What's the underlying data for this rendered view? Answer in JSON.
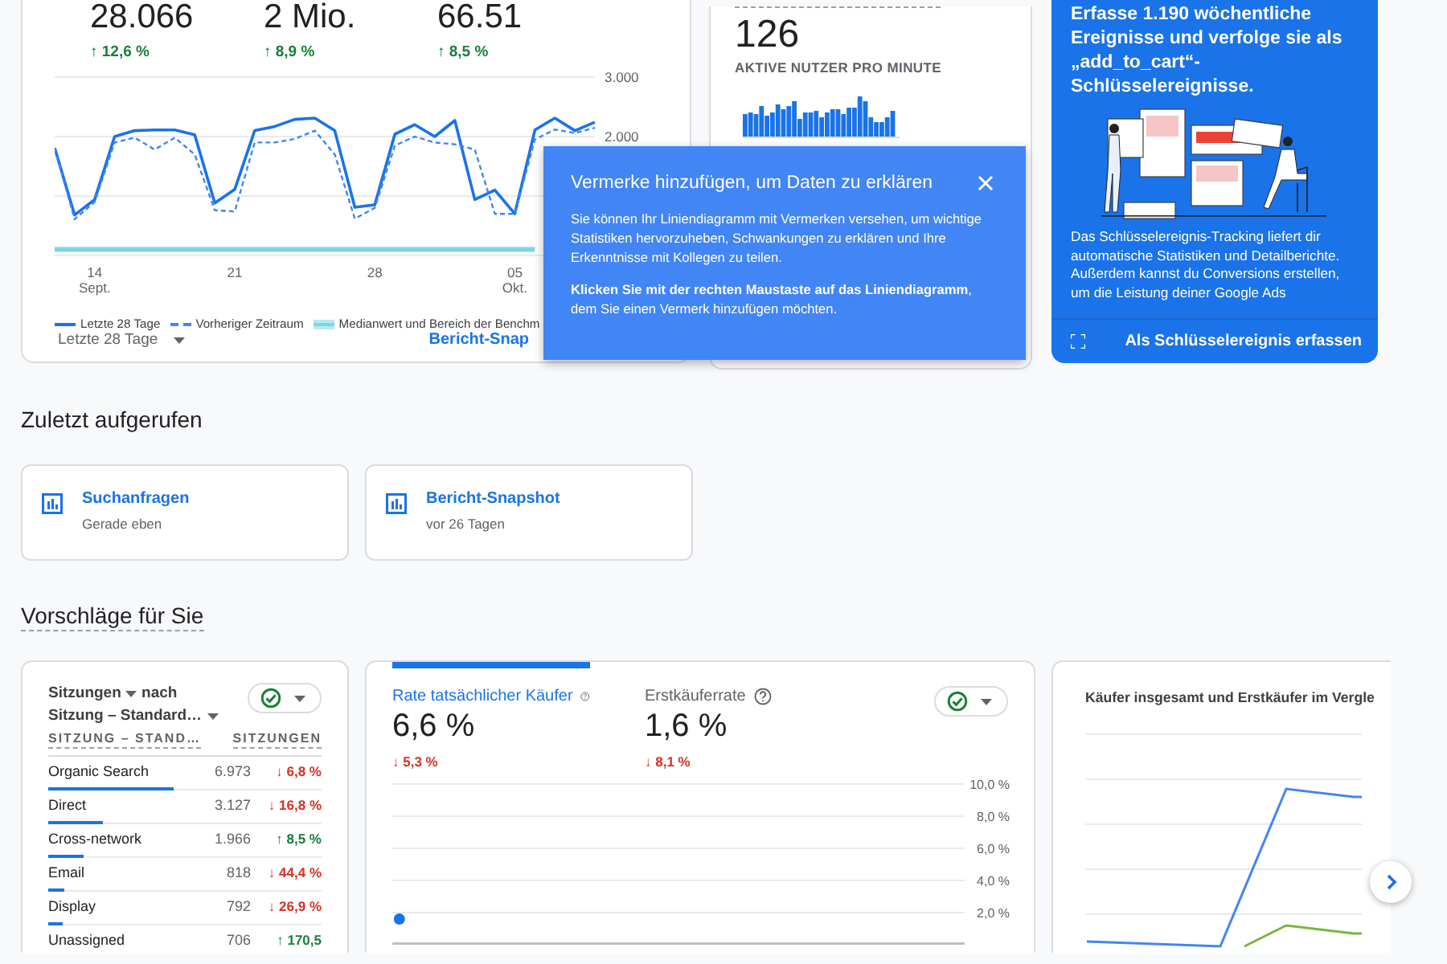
{
  "overview": {
    "metrics": [
      {
        "value": "28.066",
        "change": "↑ 12,6 %",
        "color": "#188038"
      },
      {
        "value": "2 Mio.",
        "change": "↑ 8,9 %",
        "color": "#188038"
      },
      {
        "value": "66.51",
        "change": "↑ 8,5 %",
        "color": "#188038"
      }
    ],
    "chart_data": {
      "type": "line",
      "categories": [
        null,
        null,
        "14 Sept.",
        null,
        null,
        null,
        null,
        null,
        null,
        "21",
        null,
        null,
        null,
        null,
        null,
        null,
        "28",
        null,
        null,
        null,
        null,
        null,
        null,
        "05 Okt.",
        null,
        null,
        null,
        null
      ],
      "ylim": [
        0,
        3000
      ],
      "grid": true,
      "yticks": [
        {
          "value": 2000,
          "label": "2.000"
        },
        {
          "value": 3000,
          "label": "3.000"
        }
      ],
      "series": [
        {
          "name": "Letzte 28 Tage",
          "color": "#1a73e8",
          "line_style": "solid",
          "values": [
            1810,
            680,
            940,
            2000,
            2100,
            2110,
            2110,
            2030,
            880,
            1110,
            2100,
            2170,
            2290,
            2310,
            2100,
            810,
            850,
            2040,
            2200,
            2000,
            2270,
            940,
            1100,
            700,
            2110,
            2310,
            2100,
            2240
          ]
        },
        {
          "name": "Vorheriger Zeitraum",
          "color": "#4285f4",
          "line_style": "dashed",
          "values": [
            1800,
            610,
            900,
            1900,
            1980,
            1780,
            1980,
            1700,
            760,
            740,
            1900,
            1900,
            1960,
            2100,
            1700,
            620,
            800,
            1850,
            2000,
            1900,
            1870,
            1780,
            700,
            700,
            1950,
            2120,
            2060,
            2150
          ]
        },
        {
          "name": "Medianwert und Bereich der Benchm",
          "color": "#80d4dc",
          "line_style": "solid",
          "values": [
            100,
            100,
            100,
            100,
            100,
            100,
            100,
            100,
            100,
            100,
            100,
            100,
            100,
            100,
            100,
            100,
            100,
            100,
            100,
            100,
            100,
            100,
            100,
            100,
            100,
            null,
            null,
            null
          ]
        }
      ]
    },
    "date_range": "Letzte 28 Tage",
    "link": "Bericht-Snap"
  },
  "realtime": {
    "value": "126",
    "label": "AKTIVE NUTZER PRO MINUTE"
  },
  "promo": {
    "headline": "Erfasse 1.190 wöchentliche Ereignisse und verfolge sie als „add_to_cart“-Schlüsselereignisse.",
    "body": "Das Schlüsselereignis-Tracking liefert dir automatische Statistiken und Detailberichte. Außerdem kannst du Conversions erstellen, um die Leistung deiner Google Ads",
    "action": "Als Schlüsselereignis erfassen"
  },
  "popup": {
    "title": "Vermerke hinzufügen, um Daten zu erklären",
    "body": "Sie können Ihr Liniendiagramm mit Vermerken versehen, um wichtige Statistiken hervorzuheben, Schwankungen zu erklären und Ihre Erkenntnisse mit Kollegen zu teilen.",
    "hint": "**Klicken Sie mit der rechten Maustaste auf das Liniendiagramm**, dem Sie einen Vermerk hinzufügen möchten."
  },
  "recent": {
    "heading": "Zuletzt aufgerufen",
    "items": [
      {
        "title": "Suchanfragen",
        "time": "Gerade eben"
      },
      {
        "title": "Bericht-Snapshot",
        "time": "vor 26 Tagen"
      }
    ]
  },
  "suggestions": {
    "heading": "Vorschläge für Sie",
    "table_card": {
      "metric": "Sitzungen",
      "joiner": "nach",
      "dimension": "Sitzung – Standard…",
      "columns": [
        "SITZUNG – STAND…",
        "SITZUNGEN"
      ],
      "rows": [
        {
          "name": "Organic Search",
          "value": "6.973",
          "change": "↓ 6,8 %",
          "color": "#d93025",
          "level": 0.46
        },
        {
          "name": "Direct",
          "value": "3.127",
          "change": "↓ 16,8 %",
          "color": "#d93025",
          "level": 0.2
        },
        {
          "name": "Cross-network",
          "value": "1.966",
          "change": "↑ 8,5 %",
          "color": "#188038",
          "level": 0.13
        },
        {
          "name": "Email",
          "value": "818",
          "change": "↓ 44,4 %",
          "color": "#d93025",
          "level": 0.06
        },
        {
          "name": "Display",
          "value": "792",
          "change": "↓ 26,9 %",
          "color": "#d93025",
          "level": 0.05
        },
        {
          "name": "Unassigned",
          "value": "706",
          "change": "↑ 170,5",
          "color": "#188038"
        }
      ]
    },
    "rate_card": {
      "metrics": [
        {
          "label": "Rate tatsächlicher Käufer",
          "value": "6,6 %",
          "change": "↓ 5,3 %",
          "color": "#d93025",
          "selected": true
        },
        {
          "label": "Erstkäuferrate",
          "value": "1,6 %",
          "change": "↓ 8,1 %",
          "color": "#d93025",
          "selected": false
        }
      ],
      "chart_data": {
        "type": "line",
        "categories": [
          null,
          null,
          null,
          null,
          null,
          null,
          null,
          null,
          null,
          null,
          null,
          null,
          null,
          null,
          null,
          null,
          null,
          null,
          null,
          null,
          null,
          null,
          null,
          null,
          null,
          null,
          null,
          null
        ],
        "grid": true,
        "ylim": [
          0,
          10
        ],
        "yticks": [
          {
            "value": 2,
            "label": "2,0 %"
          },
          {
            "value": 4,
            "label": "4,0 %"
          },
          {
            "value": 6,
            "label": "6,0 %"
          },
          {
            "value": 8,
            "label": "8,0 %"
          },
          {
            "value": 10,
            "label": "10,0 %"
          }
        ],
        "series": [
          {
            "color": "#1a73e8",
            "marker": "circle",
            "values": [
              1.6,
              null,
              null,
              null,
              null,
              null,
              null,
              null,
              null,
              null,
              null,
              null,
              null,
              null,
              null,
              null,
              null,
              null,
              null,
              null,
              null,
              null,
              null,
              null,
              null,
              null,
              null,
              null
            ]
          }
        ]
      }
    },
    "compare_card": {
      "title": "Käufer insgesamt und Erstkäufer im Vergle"
    }
  }
}
